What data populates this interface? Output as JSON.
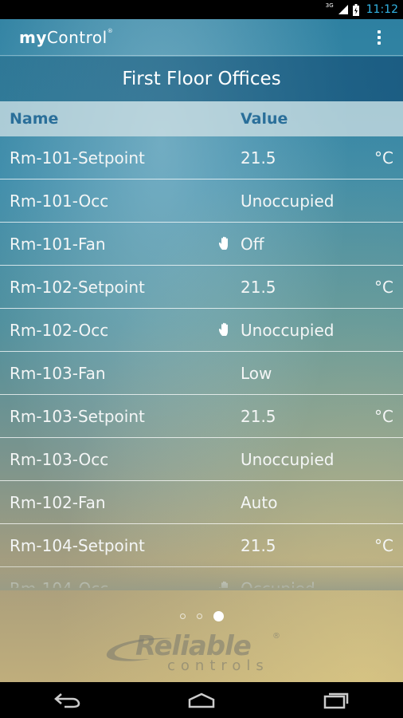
{
  "status_bar": {
    "network": "3G",
    "time": "11:12"
  },
  "app": {
    "title_bold": "my",
    "title_rest": "Control",
    "registered": "®"
  },
  "page_title": "First Floor Offices",
  "table": {
    "headers": {
      "name": "Name",
      "value": "Value"
    },
    "rows": [
      {
        "name": "Rm-101-Setpoint",
        "value": "21.5",
        "unit": "°C",
        "hand": false
      },
      {
        "name": "Rm-101-Occ",
        "value": "Unoccupied",
        "unit": "",
        "hand": false
      },
      {
        "name": "Rm-101-Fan",
        "value": "Off",
        "unit": "",
        "hand": true
      },
      {
        "name": "Rm-102-Setpoint",
        "value": "21.5",
        "unit": "°C",
        "hand": false
      },
      {
        "name": "Rm-102-Occ",
        "value": "Unoccupied",
        "unit": "",
        "hand": true
      },
      {
        "name": "Rm-103-Fan",
        "value": "Low",
        "unit": "",
        "hand": false
      },
      {
        "name": "Rm-103-Setpoint",
        "value": "21.5",
        "unit": "°C",
        "hand": false
      },
      {
        "name": "Rm-103-Occ",
        "value": "Unoccupied",
        "unit": "",
        "hand": false
      },
      {
        "name": "Rm-102-Fan",
        "value": "Auto",
        "unit": "",
        "hand": false
      },
      {
        "name": "Rm-104-Setpoint",
        "value": "21.5",
        "unit": "°C",
        "hand": false
      },
      {
        "name": "Rm-104-Occ",
        "value": "Occupied",
        "unit": "",
        "hand": true
      }
    ]
  },
  "pager": {
    "pages": 3,
    "active_index": 2
  },
  "logo": {
    "main": "Reliable",
    "sub": "controls",
    "registered": "®"
  },
  "icons": {
    "hand": "manual-override-hand-icon",
    "overflow": "overflow-menu-icon",
    "back": "back-icon",
    "home": "home-icon",
    "recents": "recent-apps-icon"
  },
  "colors": {
    "header_text": "#2a6f9a",
    "status_time": "#33b5e5"
  }
}
